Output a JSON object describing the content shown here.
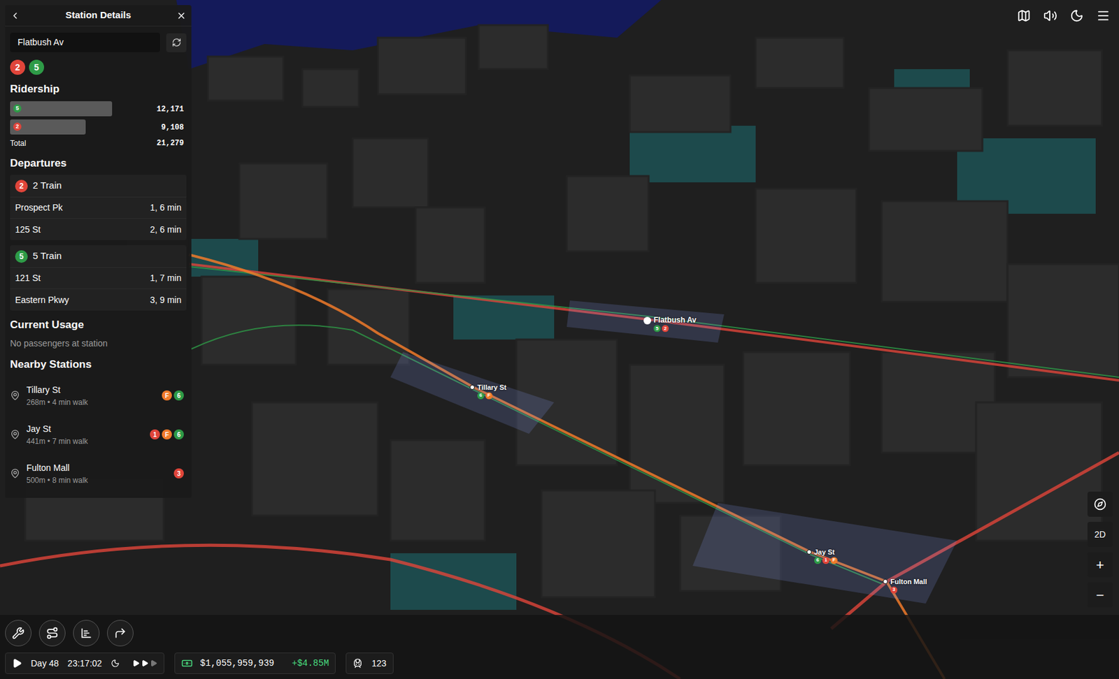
{
  "panel": {
    "title": "Station Details",
    "search": {
      "value": "Flatbush Av"
    },
    "lines": [
      {
        "label": "2",
        "color": "#e0453a"
      },
      {
        "label": "5",
        "color": "#2e9b47"
      }
    ],
    "ridership": {
      "title": "Ridership",
      "rows": [
        {
          "line": "5",
          "color": "#2e9b47",
          "value": "12,171",
          "level": 0.58
        },
        {
          "line": "2",
          "color": "#e0453a",
          "value": "9,108",
          "level": 0.43
        }
      ],
      "total_label": "Total",
      "total": "21,279"
    },
    "departures": {
      "title": "Departures",
      "groups": [
        {
          "line": "2",
          "color": "#e0453a",
          "title": "2 Train",
          "rows": [
            {
              "destination": "Prospect Pk",
              "times": "1, 6 min"
            },
            {
              "destination": "125 St",
              "times": "2, 6 min"
            }
          ]
        },
        {
          "line": "5",
          "color": "#2e9b47",
          "title": "5 Train",
          "rows": [
            {
              "destination": "121 St",
              "times": "1, 7 min"
            },
            {
              "destination": "Eastern Pkwy",
              "times": "3, 9 min"
            }
          ]
        }
      ]
    },
    "current_usage": {
      "title": "Current Usage",
      "message": "No passengers at station"
    },
    "nearby": {
      "title": "Nearby Stations",
      "items": [
        {
          "name": "Tillary St",
          "detail": "268m • 4 min walk",
          "lines": [
            {
              "label": "F",
              "color": "#f07a2a"
            },
            {
              "label": "6",
              "color": "#2e9b47"
            }
          ]
        },
        {
          "name": "Jay St",
          "detail": "441m • 7 min walk",
          "lines": [
            {
              "label": "1",
              "color": "#e0453a"
            },
            {
              "label": "F",
              "color": "#f07a2a"
            },
            {
              "label": "6",
              "color": "#2e9b47"
            }
          ]
        },
        {
          "name": "Fulton Mall",
          "detail": "500m • 8 min walk",
          "lines": [
            {
              "label": "3",
              "color": "#e0453a"
            }
          ]
        }
      ]
    }
  },
  "map": {
    "stations": [
      {
        "name": "Flatbush Av",
        "selected": true,
        "lines": [
          {
            "label": "5",
            "color": "#2e9b47"
          },
          {
            "label": "2",
            "color": "#e0453a"
          }
        ]
      },
      {
        "name": "Tillary St",
        "selected": false,
        "lines": [
          {
            "label": "6",
            "color": "#2e9b47"
          },
          {
            "label": "F",
            "color": "#f07a2a"
          }
        ]
      },
      {
        "name": "Jay St",
        "selected": false,
        "lines": [
          {
            "label": "6",
            "color": "#2e9b47"
          },
          {
            "label": "1",
            "color": "#e0453a"
          },
          {
            "label": "F",
            "color": "#f07a2a"
          }
        ]
      },
      {
        "name": "Fulton Mall",
        "selected": false,
        "lines": [
          {
            "label": "3",
            "color": "#e0453a"
          }
        ]
      }
    ]
  },
  "map_controls": {
    "view_toggle": "2D",
    "zoom_in": "+",
    "zoom_out": "−"
  },
  "status_bar": {
    "playing": false,
    "day": "Day 48",
    "time": "23:17:02",
    "speed": 2,
    "money": "$1,055,959,939",
    "money_change": "+$4.85M",
    "trains": "123"
  }
}
